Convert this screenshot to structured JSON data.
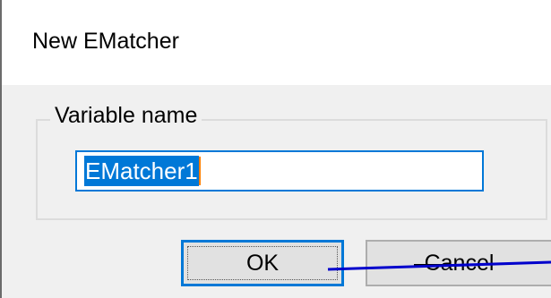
{
  "dialog": {
    "title": "New EMatcher",
    "group_label": "Variable name",
    "input_value": "EMatcher1",
    "ok_label": "OK",
    "cancel_label": "Cancel"
  },
  "colors": {
    "selection": "#0078d7",
    "caret": "#ff8000",
    "annotation_line": "#0000cc"
  }
}
